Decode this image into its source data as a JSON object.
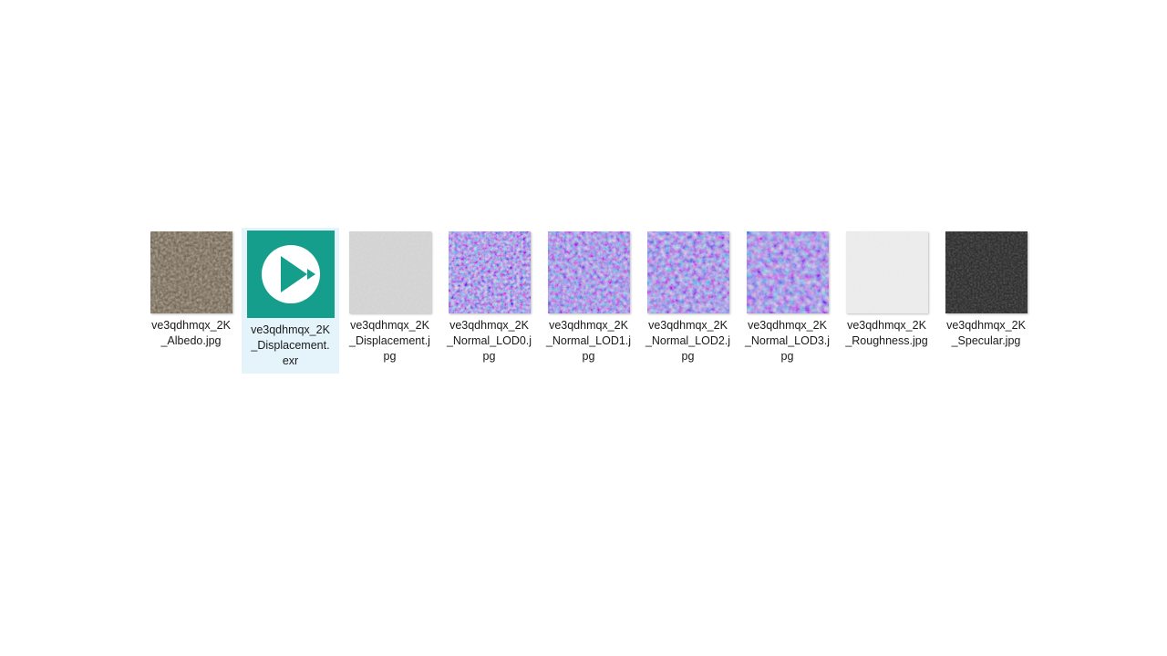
{
  "files": [
    {
      "name_line1": "ve3qdhmqx_2K",
      "name_line2": "_Albedo.jpg",
      "name_line3": "",
      "icon": "albedo-thumbnail",
      "selected": false,
      "base_color": "#6b5e4c"
    },
    {
      "name_line1": "ve3qdhmqx_2K",
      "name_line2": "_Displacement.",
      "name_line3": "exr",
      "icon": "media-player-icon",
      "selected": true,
      "base_color": "#159e8c"
    },
    {
      "name_line1": "ve3qdhmqx_2K",
      "name_line2": "_Displacement.j",
      "name_line3": "pg",
      "icon": "displacement-thumbnail",
      "selected": false,
      "base_color": "#cfcfcf"
    },
    {
      "name_line1": "ve3qdhmqx_2K",
      "name_line2": "_Normal_LOD0.j",
      "name_line3": "pg",
      "icon": "normal-map-thumbnail",
      "selected": false,
      "base_color": "#7f7fe6"
    },
    {
      "name_line1": "ve3qdhmqx_2K",
      "name_line2": "_Normal_LOD1.j",
      "name_line3": "pg",
      "icon": "normal-map-thumbnail",
      "selected": false,
      "base_color": "#8282ea"
    },
    {
      "name_line1": "ve3qdhmqx_2K",
      "name_line2": "_Normal_LOD2.j",
      "name_line3": "pg",
      "icon": "normal-map-thumbnail",
      "selected": false,
      "base_color": "#8080e8"
    },
    {
      "name_line1": "ve3qdhmqx_2K",
      "name_line2": "_Normal_LOD3.j",
      "name_line3": "pg",
      "icon": "normal-map-thumbnail",
      "selected": false,
      "base_color": "#8484ea"
    },
    {
      "name_line1": "ve3qdhmqx_2K",
      "name_line2": "_Roughness.jpg",
      "name_line3": "",
      "icon": "roughness-thumbnail",
      "selected": false,
      "base_color": "#ebebeb"
    },
    {
      "name_line1": "ve3qdhmqx_2K",
      "name_line2": "_Specular.jpg",
      "name_line3": "",
      "icon": "specular-thumbnail",
      "selected": false,
      "base_color": "#2f2f2f"
    }
  ]
}
